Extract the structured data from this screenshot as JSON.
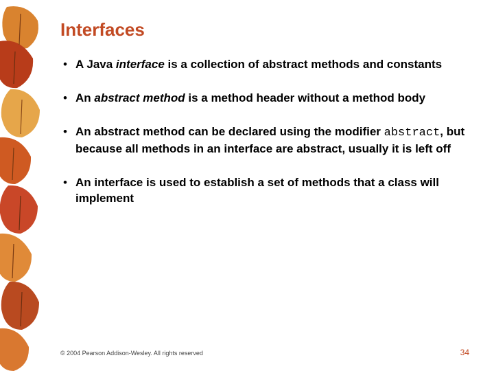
{
  "slide": {
    "title": "Interfaces",
    "bullets": {
      "b1": {
        "pre": "A Java ",
        "em": "interface",
        "post": " is a collection of abstract methods and constants"
      },
      "b2": {
        "pre": "An ",
        "em": "abstract method",
        "post": " is a method header without a method body"
      },
      "b3": {
        "pre": "An abstract method can be declared using the modifier ",
        "code": "abstract",
        "post": ", but because all methods in an interface are abstract, usually it is left off"
      },
      "b4": {
        "text": "An interface is used to establish a set of methods that a class will implement"
      }
    }
  },
  "footer": {
    "copyright": "© 2004 Pearson Addison-Wesley. All rights reserved",
    "page": "34"
  }
}
